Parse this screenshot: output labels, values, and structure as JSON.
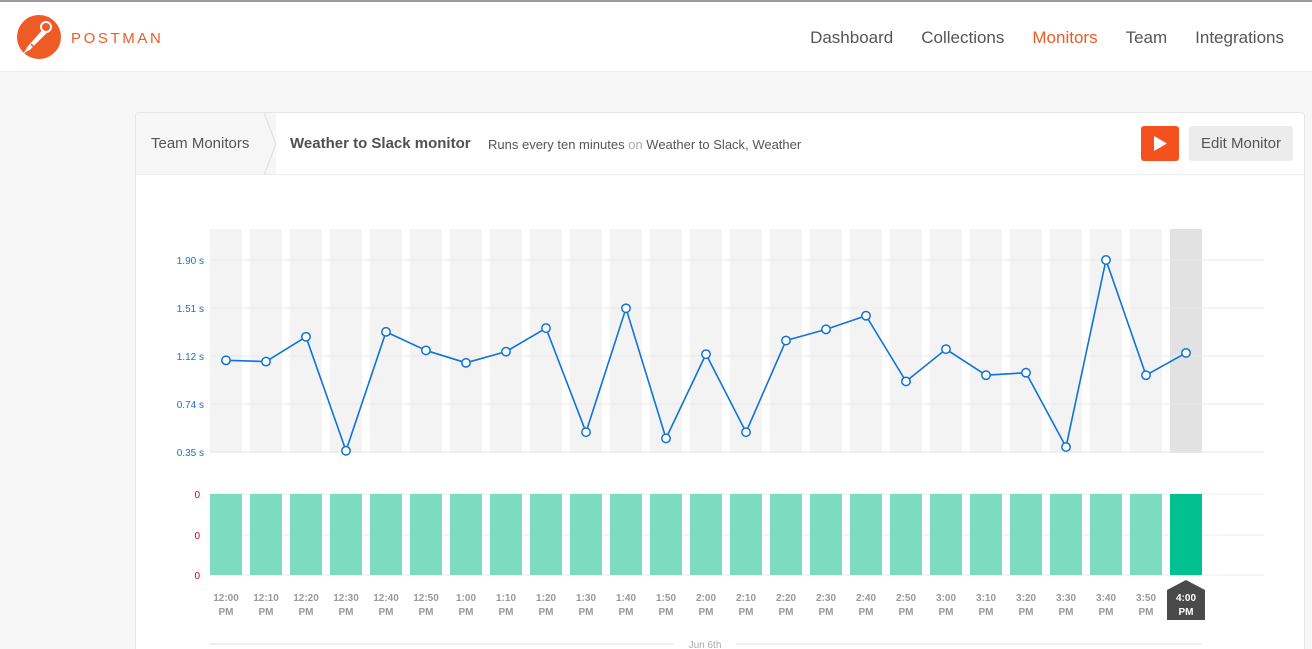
{
  "brand": {
    "name": "POSTMAN"
  },
  "nav": {
    "items": [
      {
        "label": "Dashboard",
        "active": false
      },
      {
        "label": "Collections",
        "active": false
      },
      {
        "label": "Monitors",
        "active": true
      },
      {
        "label": "Team",
        "active": false
      },
      {
        "label": "Integrations",
        "active": false
      }
    ]
  },
  "breadcrumb": {
    "root": "Team Monitors",
    "title": "Weather to Slack monitor"
  },
  "run_info": {
    "prefix": "Runs every ten minutes",
    "on": "on",
    "collection": "Weather to Slack",
    "separator": ",",
    "environment": "Weather"
  },
  "toolbar": {
    "edit_label": "Edit Monitor",
    "run_icon": "play-icon"
  },
  "colors": {
    "accent": "#f4511e",
    "line": "#0f73d6",
    "bar": "#7ddcbf",
    "bar_selected": "#02c08f",
    "axis_label": "#1a6fc9",
    "fail_axis": "#d0021b"
  },
  "chart_data": [
    {
      "type": "line",
      "title": "",
      "ylabel": "",
      "y_ticks": [
        "0.35 s",
        "0.74 s",
        "1.12 s",
        "1.51 s",
        "1.90 s"
      ],
      "ylim": [
        0.35,
        1.9
      ],
      "categories": [
        "12:00 PM",
        "12:10 PM",
        "12:20 PM",
        "12:30 PM",
        "12:40 PM",
        "12:50 PM",
        "1:00 PM",
        "1:10 PM",
        "1:20 PM",
        "1:30 PM",
        "1:40 PM",
        "1:50 PM",
        "2:00 PM",
        "2:10 PM",
        "2:20 PM",
        "2:30 PM",
        "2:40 PM",
        "2:50 PM",
        "3:00 PM",
        "3:10 PM",
        "3:20 PM",
        "3:30 PM",
        "3:40 PM",
        "3:50 PM",
        "4:00 PM"
      ],
      "series": [
        {
          "values": [
            1.09,
            1.08,
            1.28,
            0.36,
            1.32,
            1.17,
            1.07,
            1.16,
            1.35,
            0.51,
            1.51,
            0.46,
            1.14,
            0.51,
            1.25,
            1.34,
            1.45,
            0.92,
            1.18,
            0.97,
            0.99,
            0.39,
            1.9,
            0.97,
            1.15
          ]
        }
      ],
      "selected": "4:00 PM",
      "grid": true
    },
    {
      "type": "bar",
      "title": "",
      "y_ticks": [
        "0",
        "0",
        "0"
      ],
      "categories": [
        "12:00 PM",
        "12:10 PM",
        "12:20 PM",
        "12:30 PM",
        "12:40 PM",
        "12:50 PM",
        "1:00 PM",
        "1:10 PM",
        "1:20 PM",
        "1:30 PM",
        "1:40 PM",
        "1:50 PM",
        "2:00 PM",
        "2:10 PM",
        "2:20 PM",
        "2:30 PM",
        "2:40 PM",
        "2:50 PM",
        "3:00 PM",
        "3:10 PM",
        "3:20 PM",
        "3:30 PM",
        "3:40 PM",
        "3:50 PM",
        "4:00 PM"
      ],
      "series": [
        {
          "values": [
            0,
            0,
            0,
            0,
            0,
            0,
            0,
            0,
            0,
            0,
            0,
            0,
            0,
            0,
            0,
            0,
            0,
            0,
            0,
            0,
            0,
            0,
            0,
            0,
            0
          ]
        }
      ],
      "selected": "4:00 PM"
    }
  ],
  "x_axis": {
    "ticks": [
      [
        "12:00",
        "PM"
      ],
      [
        "12:10",
        "PM"
      ],
      [
        "12:20",
        "PM"
      ],
      [
        "12:30",
        "PM"
      ],
      [
        "12:40",
        "PM"
      ],
      [
        "12:50",
        "PM"
      ],
      [
        "1:00",
        "PM"
      ],
      [
        "1:10",
        "PM"
      ],
      [
        "1:20",
        "PM"
      ],
      [
        "1:30",
        "PM"
      ],
      [
        "1:40",
        "PM"
      ],
      [
        "1:50",
        "PM"
      ],
      [
        "2:00",
        "PM"
      ],
      [
        "2:10",
        "PM"
      ],
      [
        "2:20",
        "PM"
      ],
      [
        "2:30",
        "PM"
      ],
      [
        "2:40",
        "PM"
      ],
      [
        "2:50",
        "PM"
      ],
      [
        "3:00",
        "PM"
      ],
      [
        "3:10",
        "PM"
      ],
      [
        "3:20",
        "PM"
      ],
      [
        "3:30",
        "PM"
      ],
      [
        "3:40",
        "PM"
      ],
      [
        "3:50",
        "PM"
      ],
      [
        "4:00",
        "PM"
      ]
    ],
    "date_label": "Jun 6th"
  }
}
